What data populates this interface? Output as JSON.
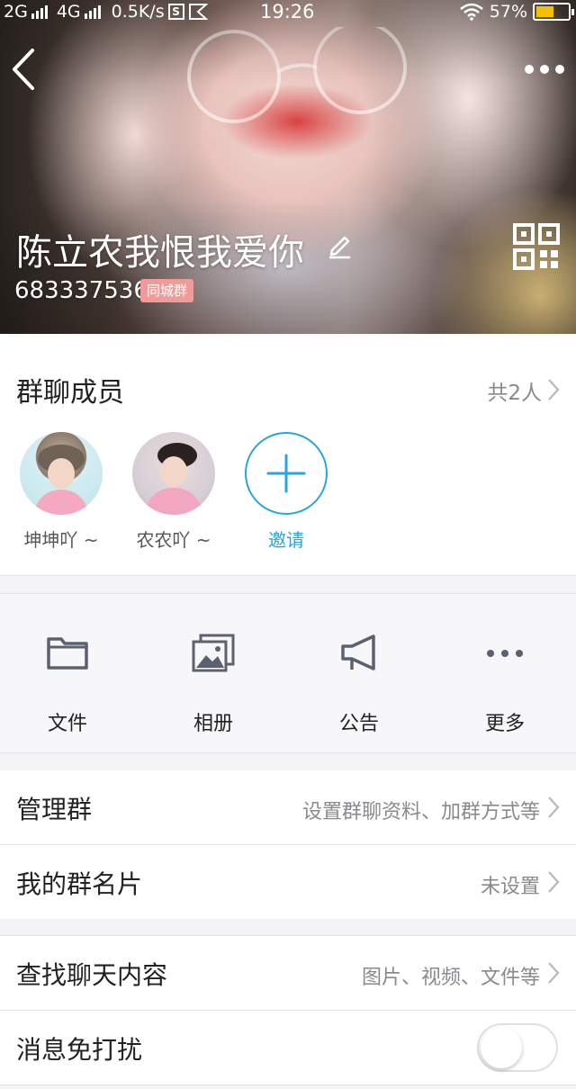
{
  "status_bar": {
    "network1": "2G",
    "network2": "4G",
    "speed": "0.5K/s",
    "time": "19:26",
    "battery": "57%",
    "battery_level": 0.57
  },
  "header": {
    "group_name": "陈立农我恨我爱你",
    "group_id": "683337536",
    "badge": "同城群"
  },
  "members": {
    "title": "群聊成员",
    "count": "共2人",
    "list": [
      {
        "name": "坤坤吖 ~"
      },
      {
        "name": "农农吖 ~"
      }
    ],
    "invite_label": "邀请"
  },
  "actions": [
    {
      "label": "文件",
      "icon": "folder-icon"
    },
    {
      "label": "相册",
      "icon": "album-icon"
    },
    {
      "label": "公告",
      "icon": "megaphone-icon"
    },
    {
      "label": "更多",
      "icon": "more-dots-icon"
    }
  ],
  "settings": {
    "manage": {
      "title": "管理群",
      "value": "设置群聊资料、加群方式等"
    },
    "card": {
      "title": "我的群名片",
      "value": "未设置"
    },
    "search": {
      "title": "查找聊天内容",
      "value": "图片、视频、文件等"
    },
    "mute": {
      "title": "消息免打扰",
      "on": false
    }
  },
  "colors": {
    "accent": "#27a6d8",
    "badge": "#f19a9a",
    "battery": "#f2c200"
  }
}
